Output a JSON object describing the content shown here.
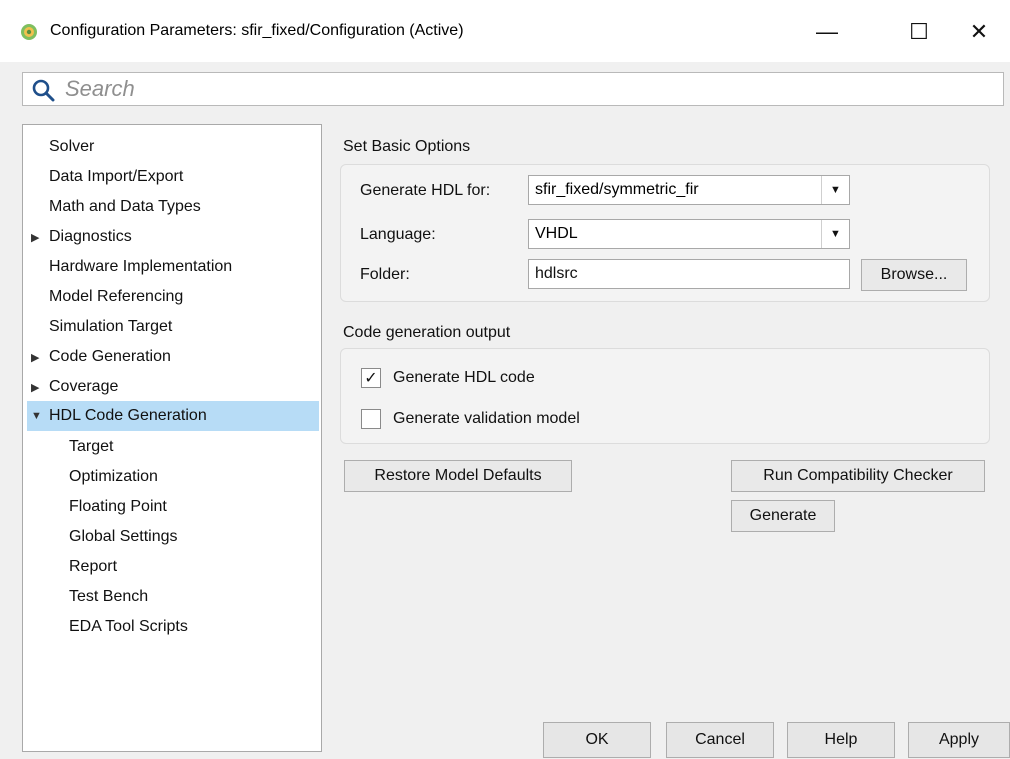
{
  "window": {
    "title": "Configuration Parameters: sfir_fixed/Configuration (Active)",
    "app_icon": "matlab-gear-icon",
    "controls": {
      "minimize": "—",
      "maximize": "☐",
      "close": "✕"
    }
  },
  "search": {
    "placeholder": "Search",
    "icon": "search-icon"
  },
  "tree": {
    "items": [
      {
        "label": "Solver",
        "arrow": ""
      },
      {
        "label": "Data Import/Export",
        "arrow": ""
      },
      {
        "label": "Math and Data Types",
        "arrow": ""
      },
      {
        "label": "Diagnostics",
        "arrow": "▶"
      },
      {
        "label": "Hardware Implementation",
        "arrow": ""
      },
      {
        "label": "Model Referencing",
        "arrow": ""
      },
      {
        "label": "Simulation Target",
        "arrow": ""
      },
      {
        "label": "Code Generation",
        "arrow": "▶"
      },
      {
        "label": "Coverage",
        "arrow": "▶"
      },
      {
        "label": "HDL Code Generation",
        "arrow": "▼",
        "selected": true
      },
      {
        "label": "Target",
        "arrow": ""
      },
      {
        "label": "Optimization",
        "arrow": ""
      },
      {
        "label": "Floating Point",
        "arrow": ""
      },
      {
        "label": "Global Settings",
        "arrow": ""
      },
      {
        "label": "Report",
        "arrow": ""
      },
      {
        "label": "Test Bench",
        "arrow": ""
      },
      {
        "label": "EDA Tool Scripts",
        "arrow": ""
      }
    ]
  },
  "basic": {
    "group_label": "Set Basic Options",
    "generate_for_label": "Generate HDL for:",
    "generate_for_value": "sfir_fixed/symmetric_fir",
    "language_label": "Language:",
    "language_value": "VHDL",
    "folder_label": "Folder:",
    "folder_value": "hdlsrc",
    "browse_label": "Browse..."
  },
  "output": {
    "group_label": "Code generation output",
    "generate_code_label": "Generate HDL code",
    "generate_code_checked": "✓",
    "validation_label": "Generate validation model",
    "validation_checked": ""
  },
  "actions": {
    "restore_label": "Restore Model Defaults",
    "compat_label": "Run Compatibility Checker",
    "generate_label": "Generate"
  },
  "footer": {
    "ok": "OK",
    "cancel": "Cancel",
    "help": "Help",
    "apply": "Apply"
  }
}
